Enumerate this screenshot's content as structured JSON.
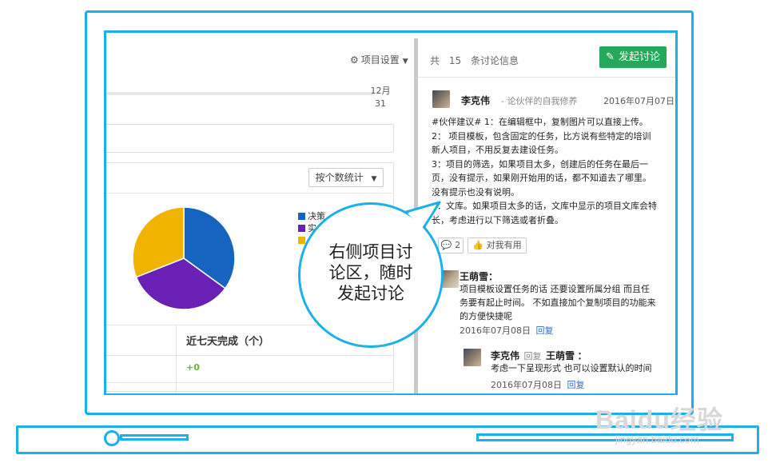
{
  "left_panel": {
    "project_settings_label": "项目设置",
    "timeline_month": "12月",
    "timeline_day": "31",
    "count_select_label": "按个数统计",
    "legend": [
      {
        "label": "决策",
        "color": "#1565c0"
      },
      {
        "label": "实",
        "color": "#6a1fb5"
      },
      {
        "label": "",
        "color": "#f0b400"
      }
    ],
    "table_header": "近七天完成（个）",
    "table_value": "+0"
  },
  "chart_data": {
    "type": "pie",
    "slices": [
      {
        "color": "#1565c0",
        "value": 35
      },
      {
        "color": "#6a1fb5",
        "value": 34
      },
      {
        "color": "#f0b400",
        "value": 31
      }
    ]
  },
  "right_panel": {
    "count_prefix": "共",
    "count_value": "15",
    "count_suffix": "条讨论信息",
    "start_discussion_label": "发起讨论",
    "post": {
      "author": "李克伟",
      "subtitle": "- 论伙伴的自我修养",
      "date": "2016年07月07日",
      "lines": [
        "#伙伴建议# 1：在编辑框中，复制图片可以直接上传。",
        "2： 项目模板，包含固定的任务，比方说有些特定的培训",
        "新人项目，不用反复去建设任务。",
        "3：项目的筛选，如果项目太多，创建后的任务在最后一",
        "页，没有提示，如果刚开始用的话，都不知道去了哪里。",
        "没有提示也没有说明。",
        "4：文库。如果项目太多的话，文库中显示的项目文库会特",
        "长，考虑进行以下筛选或者折叠。"
      ],
      "comment_count": "2",
      "useful_label": "对我有用"
    },
    "reply1": {
      "author": "王萌雪",
      "colon": "：",
      "lines": [
        "项目模板设置任务的话 还要设置所属分组 而且任",
        "务要有起止时间。 不如直接加个复制项目的功能来",
        "的方便快捷呢"
      ],
      "date": "2016年07月08日",
      "reply_label": "回复"
    },
    "reply2": {
      "author": "李克伟",
      "reply_word": "回复",
      "target": "王萌雪",
      "colon": "：",
      "text": "考虑一下呈现形式 也可以设置默认的时间",
      "date": "2016年07月08日",
      "reply_label": "回复"
    }
  },
  "callout": {
    "line1": "右侧项目讨",
    "line2": "论区，随时",
    "line3": "发起讨论"
  },
  "watermark": {
    "logo": "Baidu经验",
    "url": "jingyan.baidu.com"
  },
  "colors": {
    "frame": "#1bb0e8",
    "accent_green": "#24a85c",
    "link_blue": "#2a6fc9"
  }
}
